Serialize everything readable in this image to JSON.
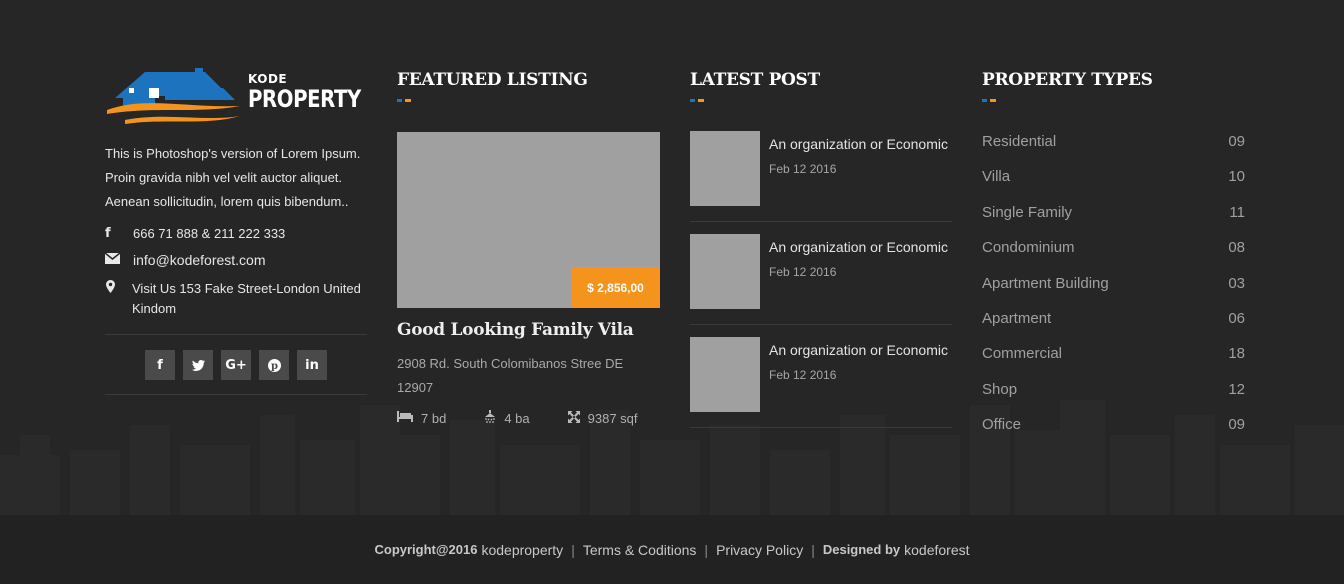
{
  "logo": {
    "word_small": "KODE",
    "word_big": "PROPERTY"
  },
  "about": {
    "text": "This is Photoshop's version of Lorem Ipsum. Proin gravida nibh vel velit auctor aliquet. Aenean sollicitudin, lorem quis bibendum..",
    "phone": "666 71 888 & 211 222 333",
    "email": "info@kodeforest.com",
    "address": "Visit Us 153 Fake Street-London United Kindom"
  },
  "social": [
    {
      "name": "facebook-icon",
      "glyph": "f"
    },
    {
      "name": "twitter-icon",
      "glyph": "t"
    },
    {
      "name": "google-plus-icon",
      "glyph": "G+"
    },
    {
      "name": "pinterest-icon",
      "glyph": "P"
    },
    {
      "name": "linkedin-icon",
      "glyph": "in"
    }
  ],
  "featured": {
    "heading": "FEATURED LISTING",
    "price": "$ 2,856,00",
    "title": "Good Looking Family Vila",
    "address": "2908 Rd. South Colomibanos Stree DE 12907",
    "beds": "7 bd",
    "baths": "4 ba",
    "area": "9387 sqf"
  },
  "latest": {
    "heading": "LATEST POST",
    "posts": [
      {
        "title": "An organization or Economic",
        "date": "Feb 12 2016"
      },
      {
        "title": "An organization or Economic",
        "date": "Feb 12 2016"
      },
      {
        "title": "An organization or Economic",
        "date": "Feb 12 2016"
      }
    ]
  },
  "types": {
    "heading": "PROPERTY TYPES",
    "items": [
      {
        "label": "Residential",
        "count": "09"
      },
      {
        "label": "Villa",
        "count": "10"
      },
      {
        "label": "Single Family",
        "count": "11"
      },
      {
        "label": "Condominium",
        "count": "08"
      },
      {
        "label": "Apartment Building",
        "count": "03"
      },
      {
        "label": "Apartment",
        "count": "06"
      },
      {
        "label": "Commercial",
        "count": "18"
      },
      {
        "label": "Shop",
        "count": "12"
      },
      {
        "label": "Office",
        "count": "09"
      }
    ]
  },
  "bottom": {
    "copyright_label": "Copyright@2016",
    "copyright_name": "kodeproperty",
    "terms": "Terms & Coditions",
    "privacy": "Privacy Policy",
    "designed_label": "Designed by",
    "designer": "kodeforest"
  },
  "colors": {
    "accent_blue": "#1e73be",
    "accent_orange": "#f5941d",
    "background": "#262626"
  }
}
